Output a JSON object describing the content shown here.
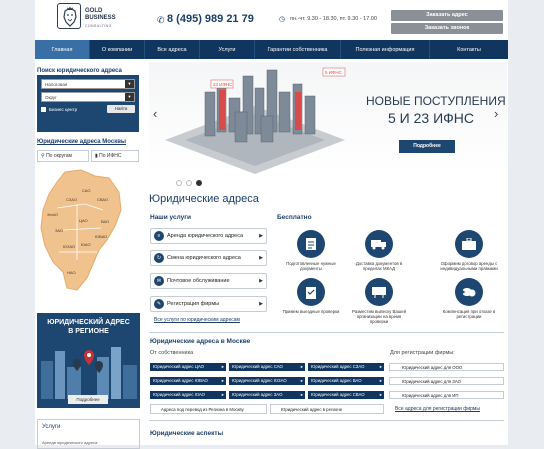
{
  "header": {
    "logo_line1": "GOLD",
    "logo_line2": "BUSINESS",
    "logo_sub": "CONSULTING",
    "phone": "8 (495) 989 21 79",
    "hours": "пн.-чт. 9.30 - 18.30, пт. 9.30 - 17.00",
    "btn_order_address": "Заказать адрес",
    "btn_order_call": "Заказать звонок"
  },
  "nav": [
    "Главная",
    "О компании",
    "Все адреса",
    "Услуги",
    "Гарантии собственника",
    "Полезная информация",
    "Контакты"
  ],
  "sidebar": {
    "search_title": "Поиск юридического адреса",
    "select_tax": "Налоговая",
    "select_district": "Округ",
    "business_center": "Бизнес центр",
    "find_btn": "Найти",
    "moscow_title": "Юридические адреса Москвы",
    "tab_districts": "По округам",
    "tab_ifns": "По ИФНС",
    "promo_line1": "ЮРИДИЧЕСКИЙ АДРЕС",
    "promo_line2": "В РЕГИОНЕ",
    "promo_btn": "Подробнее",
    "services_title": "Услуги",
    "services_sub": "Аренда юридического адреса"
  },
  "map_labels": [
    "СЗАО",
    "САО",
    "СВАО",
    "ЗелАО",
    "ВАО",
    "ЗАО",
    "ЦАО",
    "ЮЗАО",
    "ЮАО",
    "ЮВАО",
    "НАО"
  ],
  "banner": {
    "label_left": "23 ИФНС",
    "label_right": "5 ИФНС",
    "title1": "НОВЫЕ ПОСТУПЛЕНИЯ",
    "title2": "5 И 23 ИФНС",
    "btn": "Подробнее"
  },
  "main": {
    "title": "Юридические адреса",
    "services_title": "Наши услуги",
    "services": [
      "Аренда юридического адреса",
      "Смена юридического адреса",
      "Почтовое обслуживание",
      "Регистрация фирмы"
    ],
    "services_link": "Все услуги по юридическим адресам",
    "benefits_title": "Бесплатно",
    "benefits": [
      "Подготовленные нужные документы",
      "Доставка документов в пределах МКАД",
      "Оформим договор аренды с индивидуальными правками",
      "Примем выездные проверки",
      "Разместим вывеску Вашей организации на время проверки",
      "Компенсация при отказе в регистрации"
    ],
    "moscow_title": "Юридические адреса в Москве",
    "owner_label": "От собственника",
    "firm_label": "Для регистрации фирмы:",
    "addresses": [
      [
        "Юридический адрес ЦАО",
        "Юридический адрес САО",
        "Юридический адрес СЗАО"
      ],
      [
        "Юридический адрес ЮВАО",
        "Юридический адрес ЮЗАО",
        "Юридический адрес ВАО"
      ],
      [
        "Юридический адрес ЮАО",
        "Юридический адрес ЗАО",
        "Юридический адрес СВАО"
      ]
    ],
    "firm_buttons": [
      "Юридический адрес для ООО",
      "Юридический адрес для ЗАО",
      "Юридический адрес для ИП"
    ],
    "region_moscow": "Адреса под перевод из Региона в Москву",
    "region_btn": "Юридический адрес в регионе",
    "all_link": "Все адреса для регистрации фирмы",
    "aspects_title": "Юридические аспекты"
  }
}
